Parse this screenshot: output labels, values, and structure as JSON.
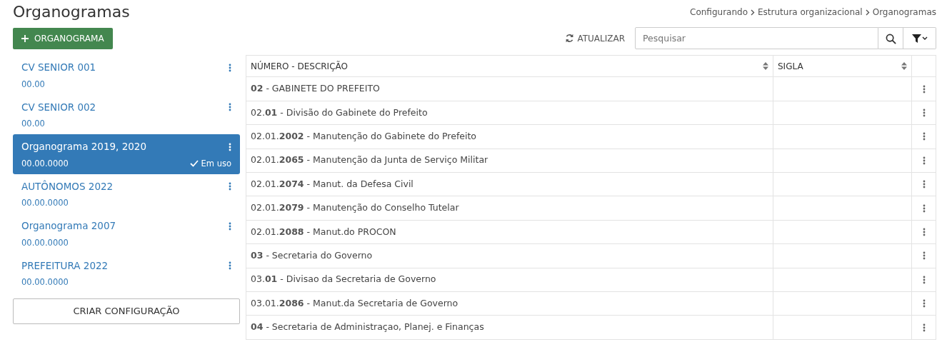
{
  "page_title": "Organogramas",
  "breadcrumb": [
    "Configurando",
    "Estrutura organizacional",
    "Organogramas"
  ],
  "add_button": "ORGANOGRAMA",
  "refresh_button": "ATUALIZAR",
  "search": {
    "placeholder": "Pesquisar"
  },
  "organograms": [
    {
      "name": "CV SENIOR 001",
      "code": "00.00",
      "selected": false
    },
    {
      "name": "CV SENIOR 002",
      "code": "00.00",
      "selected": false
    },
    {
      "name": "Organograma 2019, 2020",
      "code": "00.00.0000",
      "selected": true,
      "status": "Em uso"
    },
    {
      "name": "AUTÔNOMOS 2022",
      "code": "00.00.0000",
      "selected": false
    },
    {
      "name": "Organograma 2007",
      "code": "00.00.0000",
      "selected": false
    },
    {
      "name": "PREFEITURA 2022",
      "code": "00.00.0000",
      "selected": false
    }
  ],
  "create_button": "CRIAR CONFIGURAÇÃO",
  "table": {
    "columns": [
      "NÚMERO - DESCRIÇÃO",
      "SIGLA"
    ],
    "rows": [
      {
        "description": "**02** - GABINETE DO PREFEITO"
      },
      {
        "description": "02.**01** - Divisão do Gabinete do Prefeito"
      },
      {
        "description": "02.01.**2002** - Manutenção do Gabinete do Prefeito"
      },
      {
        "description": "02.01.**2065** - Manutenção da Junta de Serviço Militar"
      },
      {
        "description": "02.01.**2074** - Manut. da Defesa Civil"
      },
      {
        "description": "02.01.**2079** - Manutenção do Conselho Tutelar"
      },
      {
        "description": "02.01.**2088** - Manut.do PROCON"
      },
      {
        "description": "**03** - Secretaria do Governo"
      },
      {
        "description": "03.**01** - Divisao da Secretaria de Governo"
      },
      {
        "description": "03.01.**2086** - Manut.da Secretaria de Governo"
      },
      {
        "description": "**04** - Secretaria de Administraçao, Planej. e Finanças"
      }
    ]
  }
}
